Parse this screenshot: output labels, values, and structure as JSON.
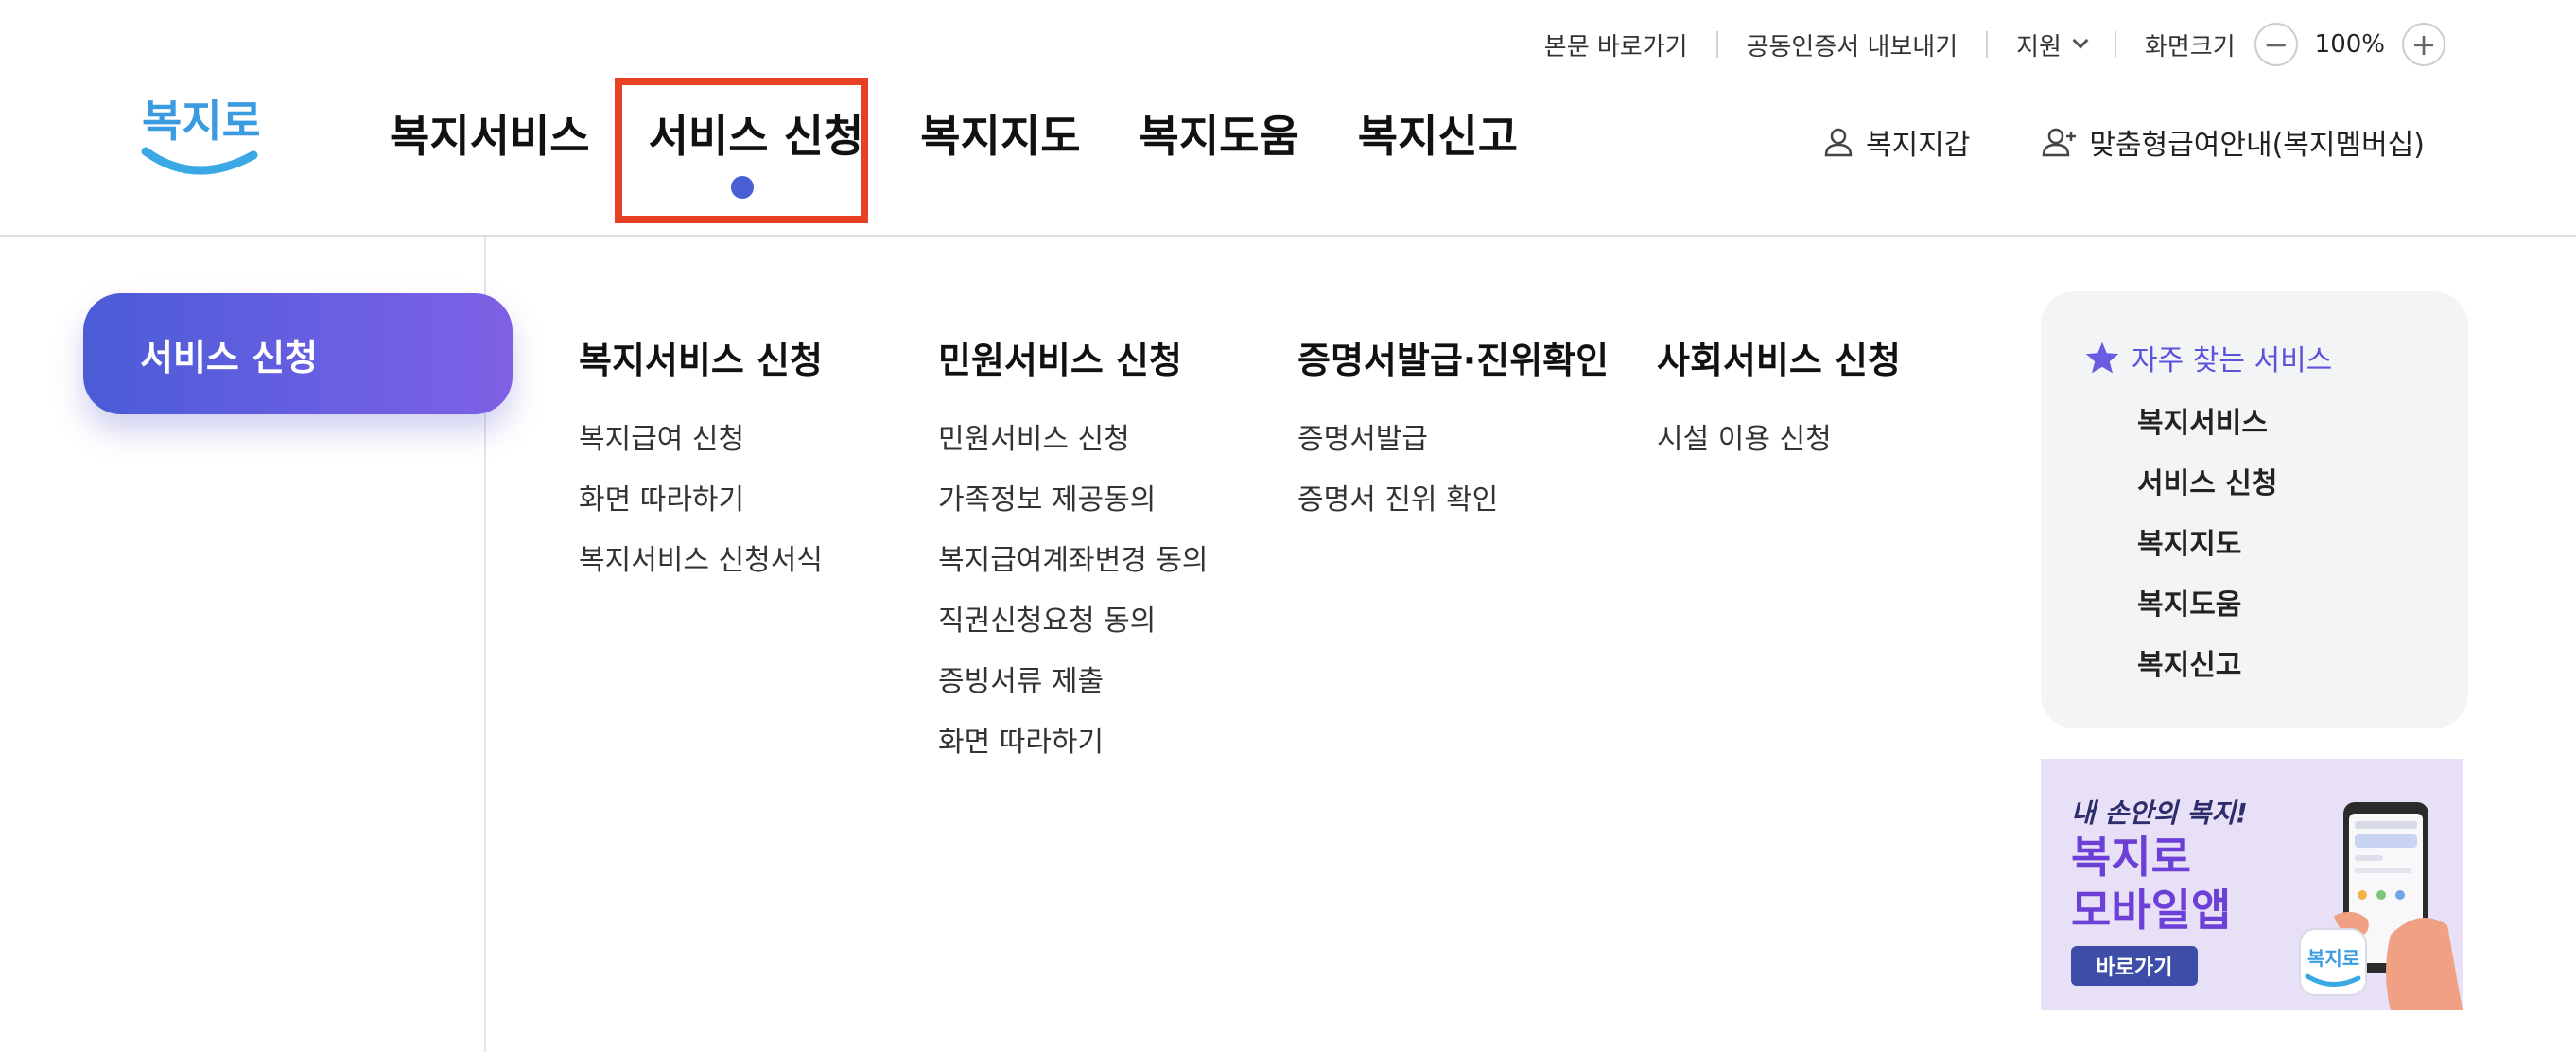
{
  "util_bar": {
    "skip_to_content": "본문 바로가기",
    "export_cert": "공동인증서 내보내기",
    "support": "지원",
    "zoom_label": "화면크기",
    "zoom_minus": "−",
    "zoom_value": "100%",
    "zoom_plus": "+"
  },
  "logo": {
    "text": "복지로"
  },
  "gnb": {
    "items": [
      {
        "label": "복지서비스"
      },
      {
        "label": "서비스 신청"
      },
      {
        "label": "복지지도"
      },
      {
        "label": "복지도움"
      },
      {
        "label": "복지신고"
      }
    ],
    "active_index": 1
  },
  "user_links": {
    "wallet": "복지지갑",
    "membership": "맞춤형급여안내(복지멤버십)"
  },
  "side": {
    "title": "서비스 신청"
  },
  "menu": {
    "columns": [
      {
        "title": "복지서비스 신청",
        "items": [
          "복지급여 신청",
          "화면 따라하기",
          "복지서비스 신청서식"
        ]
      },
      {
        "title": "민원서비스 신청",
        "items": [
          "민원서비스 신청",
          "가족정보 제공동의",
          "복지급여계좌변경 동의",
          "직권신청요청 동의",
          "증빙서류 제출",
          "화면 따라하기"
        ]
      },
      {
        "title": "증명서발급·진위확인",
        "items": [
          "증명서발급",
          "증명서 진위 확인"
        ]
      },
      {
        "title": "사회서비스 신청",
        "items": [
          "시설 이용 신청"
        ]
      }
    ]
  },
  "favorites": {
    "title": "자주 찾는 서비스",
    "items": [
      "복지서비스",
      "서비스 신청",
      "복지지도",
      "복지도움",
      "복지신고"
    ]
  },
  "banner": {
    "subtitle": "내 손안의 복지!",
    "title_line1": "복지로",
    "title_line2": "모바일앱",
    "button": "바로가기",
    "app_icon_text": "복지로"
  },
  "colors": {
    "accent": "#4a5fd4",
    "highlight_box": "#e64124",
    "favorites_title": "#5a55d8"
  }
}
